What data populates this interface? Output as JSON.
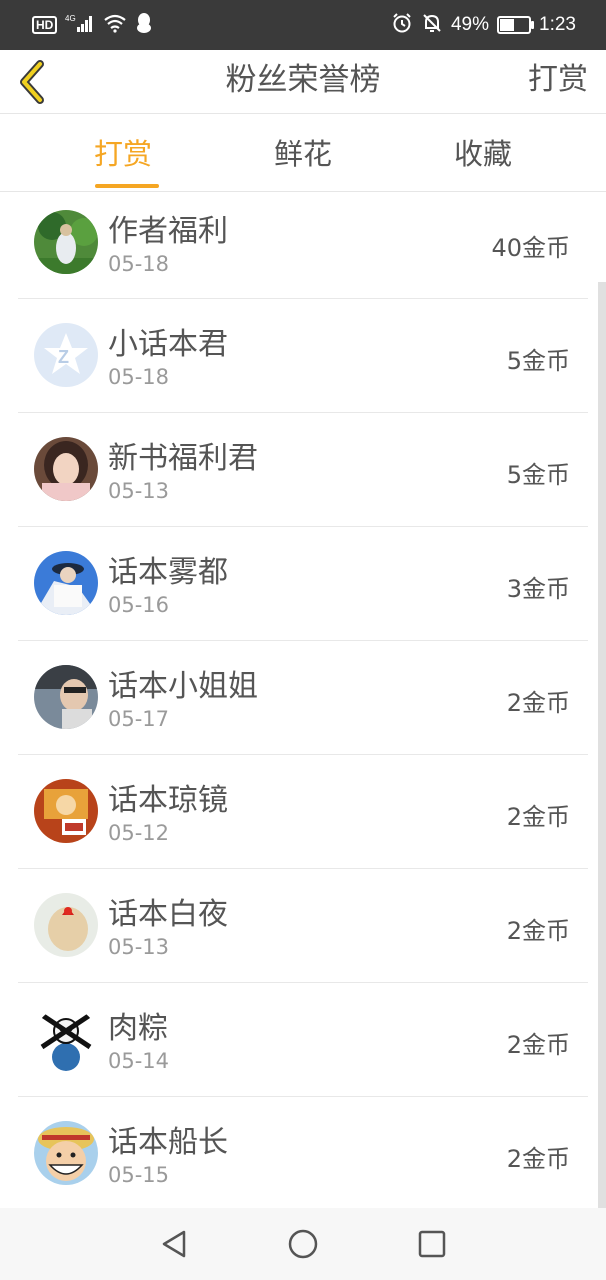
{
  "status_bar": {
    "hd": "HD",
    "network": "4G",
    "battery_text": "49%",
    "battery_level": 0.49,
    "time": "1:23",
    "icons": [
      "signal-icon",
      "wifi-icon",
      "qq-icon",
      "alarm-icon",
      "mute-bell-icon",
      "battery-icon"
    ]
  },
  "header": {
    "title": "粉丝荣誉榜",
    "action_label": "打赏",
    "back_icon": "chevron-left-icon",
    "accent_color": "#f5a623"
  },
  "tabs": [
    {
      "label": "打赏",
      "active": true
    },
    {
      "label": "鲜花",
      "active": false
    },
    {
      "label": "收藏",
      "active": false
    }
  ],
  "list": [
    {
      "name": "作者福利",
      "date": "05-18",
      "amount": "40金币"
    },
    {
      "name": "小话本君",
      "date": "05-18",
      "amount": "5金币"
    },
    {
      "name": "新书福利君",
      "date": "05-13",
      "amount": "5金币"
    },
    {
      "name": "话本雾都",
      "date": "05-16",
      "amount": "3金币"
    },
    {
      "name": "话本小姐姐",
      "date": "05-17",
      "amount": "2金币"
    },
    {
      "name": "话本琼镜",
      "date": "05-12",
      "amount": "2金币"
    },
    {
      "name": "话本白夜",
      "date": "05-13",
      "amount": "2金币"
    },
    {
      "name": "肉粽",
      "date": "05-14",
      "amount": "2金币"
    },
    {
      "name": "话本船长",
      "date": "05-15",
      "amount": "2金币"
    }
  ],
  "nav_bar": {
    "icons": [
      "back-triangle-icon",
      "home-circle-icon",
      "recents-square-icon"
    ]
  }
}
